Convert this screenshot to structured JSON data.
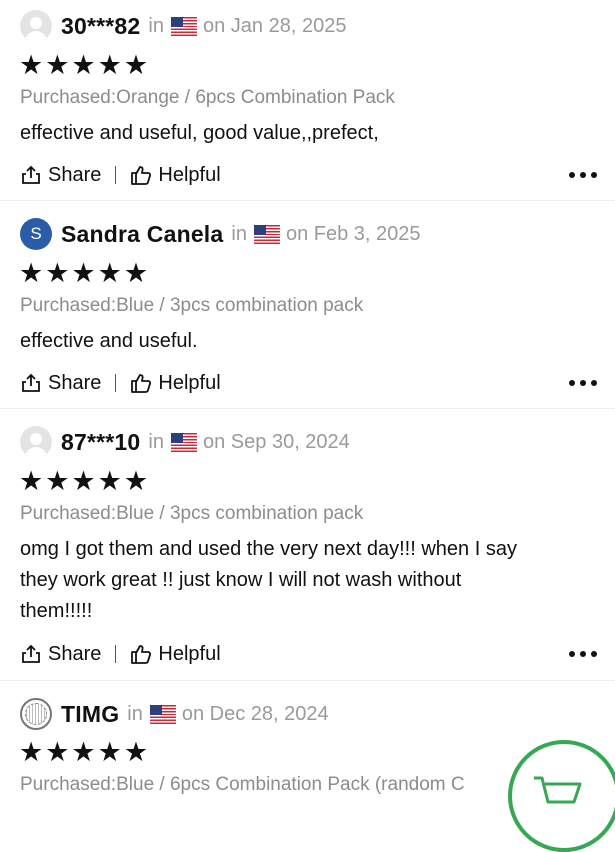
{
  "reviews": [
    {
      "user": "30***82",
      "avatar": "default-user-icon",
      "in_label": "in",
      "date": "on Jan 28, 2025",
      "stars": "★★★★★",
      "purchased": "Purchased:Orange / 6pcs Combination Pack",
      "lines": [
        "effective and useful, good value,,prefect,"
      ]
    },
    {
      "user": "Sandra Canela",
      "avatar_letter": "S",
      "in_label": "in",
      "date": "on Feb 3, 2025",
      "stars": "★★★★★",
      "purchased": "Purchased:Blue / 3pcs combination pack",
      "lines": [
        "effective and useful."
      ]
    },
    {
      "user": "87***10",
      "avatar": "default-user-icon",
      "in_label": "in",
      "date": "on Sep 30, 2024",
      "stars": "★★★★★",
      "purchased": "Purchased:Blue / 3pcs combination pack",
      "lines": [
        "omg I got them and used the very next day!!! when I say",
        "they work great !! just know I will not wash without",
        "them!!!!!"
      ]
    },
    {
      "user": "TIMG",
      "avatar": "badge-avatar",
      "in_label": "in",
      "date": "on Dec 28, 2024",
      "stars": "★★★★★",
      "purchased": "Purchased:Blue / 6pcs Combination Pack (random C"
    }
  ],
  "actions": {
    "share": "Share",
    "helpful": "Helpful"
  },
  "colors": {
    "flag_red": "#c8283a",
    "flag_blue": "#2e3f80",
    "avatar_blue": "#2a5ca8",
    "cart_green": "#36a853"
  }
}
